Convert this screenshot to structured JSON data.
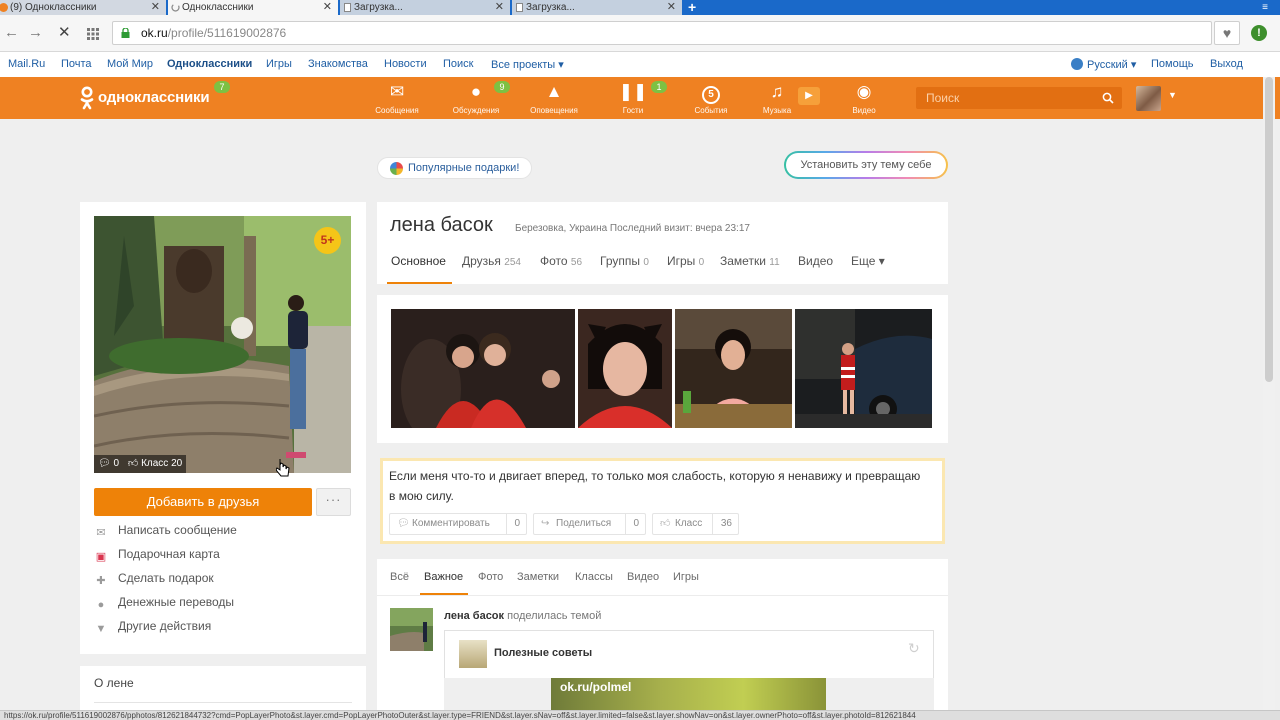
{
  "browser": {
    "tabs": [
      {
        "label": "(9) Одноклассники"
      },
      {
        "label": "Одноклассники"
      },
      {
        "label": "Загрузка..."
      },
      {
        "label": "Загрузка..."
      }
    ],
    "new_tab": "+",
    "menu": "≡",
    "url_host": "ok.ru",
    "url_path": "/profile/511619002876",
    "status_url": "https://ok.ru/profile/511619002876/pphotos/812621844732?cmd=PopLayerPhoto&st.layer.cmd=PopLayerPhotoOuter&st.layer.type=FRIEND&st.layer.sNav=off&st.layer.limited=false&st.layer.showNav=on&st.layer.ownerPhoto=off&st.layer.photoId=812621844"
  },
  "portal": {
    "links": [
      "Mail.Ru",
      "Почта",
      "Мой Мир",
      "Одноклассники",
      "Игры",
      "Знакомства",
      "Новости",
      "Поиск",
      "Все проекты ▾"
    ],
    "language": "Русский ▾",
    "help": "Помощь",
    "logout": "Выход"
  },
  "header": {
    "logo_text": "одноклассники",
    "logo_badge": "7",
    "nav": [
      {
        "label": "Сообщения",
        "icon": "envelope-icon",
        "badge": ""
      },
      {
        "label": "Обсуждения",
        "icon": "chat-bubbles-icon",
        "badge": "9"
      },
      {
        "label": "Оповещения",
        "icon": "bell-icon",
        "badge": ""
      },
      {
        "label": "Гости",
        "icon": "footprints-icon",
        "badge": "1"
      },
      {
        "label": "События",
        "icon": "events-icon",
        "badge": ""
      },
      {
        "label": "Музыка",
        "icon": "music-note-icon",
        "badge": ""
      },
      {
        "label": "Видео",
        "icon": "video-camera-icon",
        "badge": ""
      }
    ],
    "events_badge": "5",
    "search_placeholder": "Поиск"
  },
  "promo": {
    "gifts": "Популярные подарки!",
    "theme": "Установить эту тему себе"
  },
  "profile": {
    "name": "лена басок",
    "meta": "Березовка, Украина  Последний визит: вчера 23:17",
    "age_badge": "5+",
    "photo_comments": "0",
    "photo_klass": "Класс 20",
    "add_friend": "Добавить в друзья",
    "more": "···",
    "actions": [
      {
        "label": "Написать сообщение",
        "icon": "envelope-icon"
      },
      {
        "label": "Подарочная карта",
        "icon": "gift-card-icon"
      },
      {
        "label": "Сделать подарок",
        "icon": "gift-icon"
      },
      {
        "label": "Денежные переводы",
        "icon": "money-transfer-icon"
      },
      {
        "label": "Другие действия",
        "icon": "caret-down-icon"
      }
    ],
    "about": "О лене",
    "tabs": [
      {
        "label": "Основное",
        "count": ""
      },
      {
        "label": "Друзья",
        "count": "254"
      },
      {
        "label": "Фото",
        "count": "56"
      },
      {
        "label": "Группы",
        "count": "0"
      },
      {
        "label": "Игры",
        "count": "0"
      },
      {
        "label": "Заметки",
        "count": "11"
      },
      {
        "label": "Видео",
        "count": ""
      },
      {
        "label": "Еще ▾",
        "count": ""
      }
    ]
  },
  "status": {
    "text": "Если меня что-то и двигает вперед, то только моя слабость, которую я ненавижу и превращаю в мою силу.",
    "comment_label": "Комментировать",
    "comment_count": "0",
    "share_label": "Поделиться",
    "share_count": "0",
    "klass_label": "Класс",
    "klass_count": "36"
  },
  "feed": {
    "tabs": [
      "Всё",
      "Важное",
      "Фото",
      "Заметки",
      "Классы",
      "Видео",
      "Игры"
    ],
    "post_author": "лена басок",
    "post_action": "поделилась темой",
    "theme_title": "Полезные советы",
    "preview_url": "ok.ru/polmel"
  },
  "colors": {
    "ok_orange": "#ef8122",
    "button_orange": "#ee8208",
    "link_blue": "#1f5ea4",
    "badge_green": "#7dc143"
  }
}
